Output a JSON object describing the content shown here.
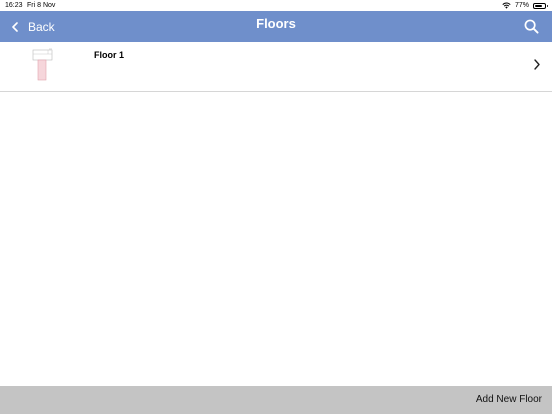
{
  "status_bar": {
    "time": "16:23",
    "date": "Fri 8 Nov",
    "battery_percent": "77%",
    "battery_level": 0.77
  },
  "nav": {
    "back_label": "Back",
    "title": "Floors",
    "accent_color": "#6f8fcb"
  },
  "floors": [
    {
      "name": "Floor 1"
    }
  ],
  "bottom_bar": {
    "add_label": "Add New Floor"
  }
}
